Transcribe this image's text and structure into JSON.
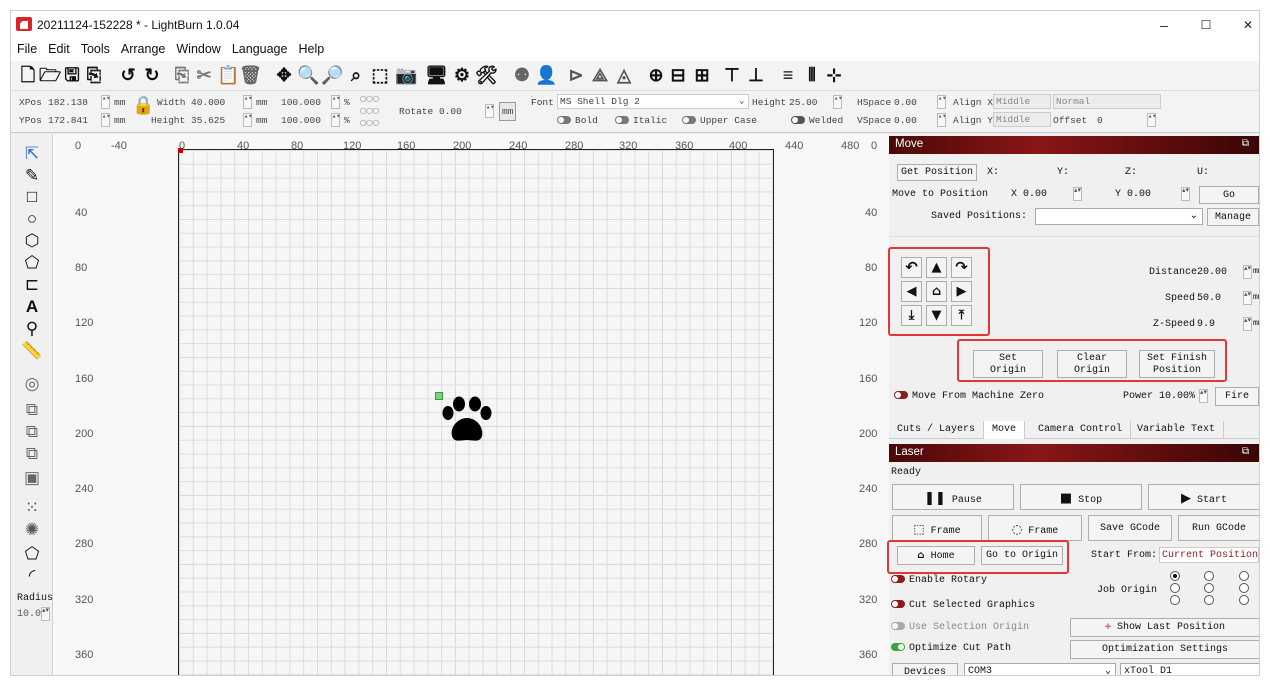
{
  "window": {
    "title": "20211124-152228 * - LightBurn 1.0.04",
    "minimize": "–",
    "maximize": "☐",
    "close": "✕"
  },
  "menu": [
    "File",
    "Edit",
    "Tools",
    "Arrange",
    "Window",
    "Language",
    "Help"
  ],
  "props": {
    "xpos_label": "XPos",
    "xpos": "182.138",
    "ypos_label": "YPos",
    "ypos": "172.841",
    "unit": "mm",
    "width_label": "Width",
    "width": "40.000",
    "height_label": "Height",
    "height": "35.625",
    "scale_w": "100.000",
    "scale_h": "100.000",
    "pct": "%",
    "rotate_label": "Rotate",
    "rotate": "0.00",
    "mm_btn": "mm",
    "font_label": "Font",
    "font": "MS Shell Dlg 2",
    "fheight_label": "Height",
    "fheight": "25.00",
    "hspace_label": "HSpace",
    "hspace": "0.00",
    "vspace_label": "VSpace",
    "vspace": "0.00",
    "alignx_label": "Align X",
    "alignx": "Middle",
    "aligny_label": "Align Y",
    "aligny": "Middle",
    "normal": "Normal",
    "offset_label": "Offset",
    "offset": "0",
    "bold": "Bold",
    "italic": "Italic",
    "upper": "Upper Case",
    "welded": "Welded"
  },
  "lefttools": {
    "radius_label": "Radius:",
    "radius": "10.0"
  },
  "ruler": {
    "top": [
      "0",
      "-40",
      "0",
      "40",
      "80",
      "120",
      "160",
      "200",
      "240",
      "280",
      "320",
      "360",
      "400",
      "440",
      "480"
    ],
    "left": [
      "40",
      "80",
      "120",
      "160",
      "200",
      "240",
      "280",
      "320",
      "360"
    ],
    "right": [
      "0",
      "40",
      "80",
      "120",
      "160",
      "200",
      "240",
      "280",
      "320",
      "360"
    ]
  },
  "move": {
    "title": "Move",
    "get_position": "Get Position",
    "x": "X:",
    "y": "Y:",
    "z": "Z:",
    "u": "U:",
    "move_to": "Move to Position",
    "mx_label": "X",
    "mx": "0.00",
    "my_label": "Y",
    "my": "0.00",
    "go": "Go",
    "saved_positions": "Saved Positions:",
    "manage": "Manage",
    "distance_label": "Distance",
    "distance": "20.00",
    "speed_label": "Speed",
    "speed": "50.0",
    "zspeed_label": "Z-Speed",
    "zspeed": "9.9",
    "unit": "mm",
    "set_origin": "Set\nOrigin",
    "clear_origin": "Clear\nOrigin",
    "set_finish": "Set Finish\nPosition",
    "move_from_zero": "Move From Machine Zero",
    "power_label": "Power",
    "power": "10.00%",
    "fire": "Fire"
  },
  "tabs": [
    "Cuts / Layers",
    "Move",
    "Camera Control",
    "Variable Text"
  ],
  "laser": {
    "title": "Laser",
    "status": "Ready",
    "pause": "Pause",
    "stop": "Stop",
    "start": "Start",
    "frame1": "Frame",
    "frame2": "Frame",
    "save_gcode": "Save GCode",
    "run_gcode": "Run GCode",
    "home": "Home",
    "go_origin": "Go to Origin",
    "start_from_label": "Start From:",
    "start_from": "Current Position",
    "enable_rotary": "Enable Rotary",
    "job_origin": "Job Origin",
    "cut_selected": "Cut Selected Graphics",
    "use_selection": "Use Selection Origin",
    "show_last": "Show Last Position",
    "optimize": "Optimize Cut Path",
    "opt_settings": "Optimization Settings",
    "devices": "Devices",
    "port": "COM3",
    "device": "xTool D1"
  }
}
